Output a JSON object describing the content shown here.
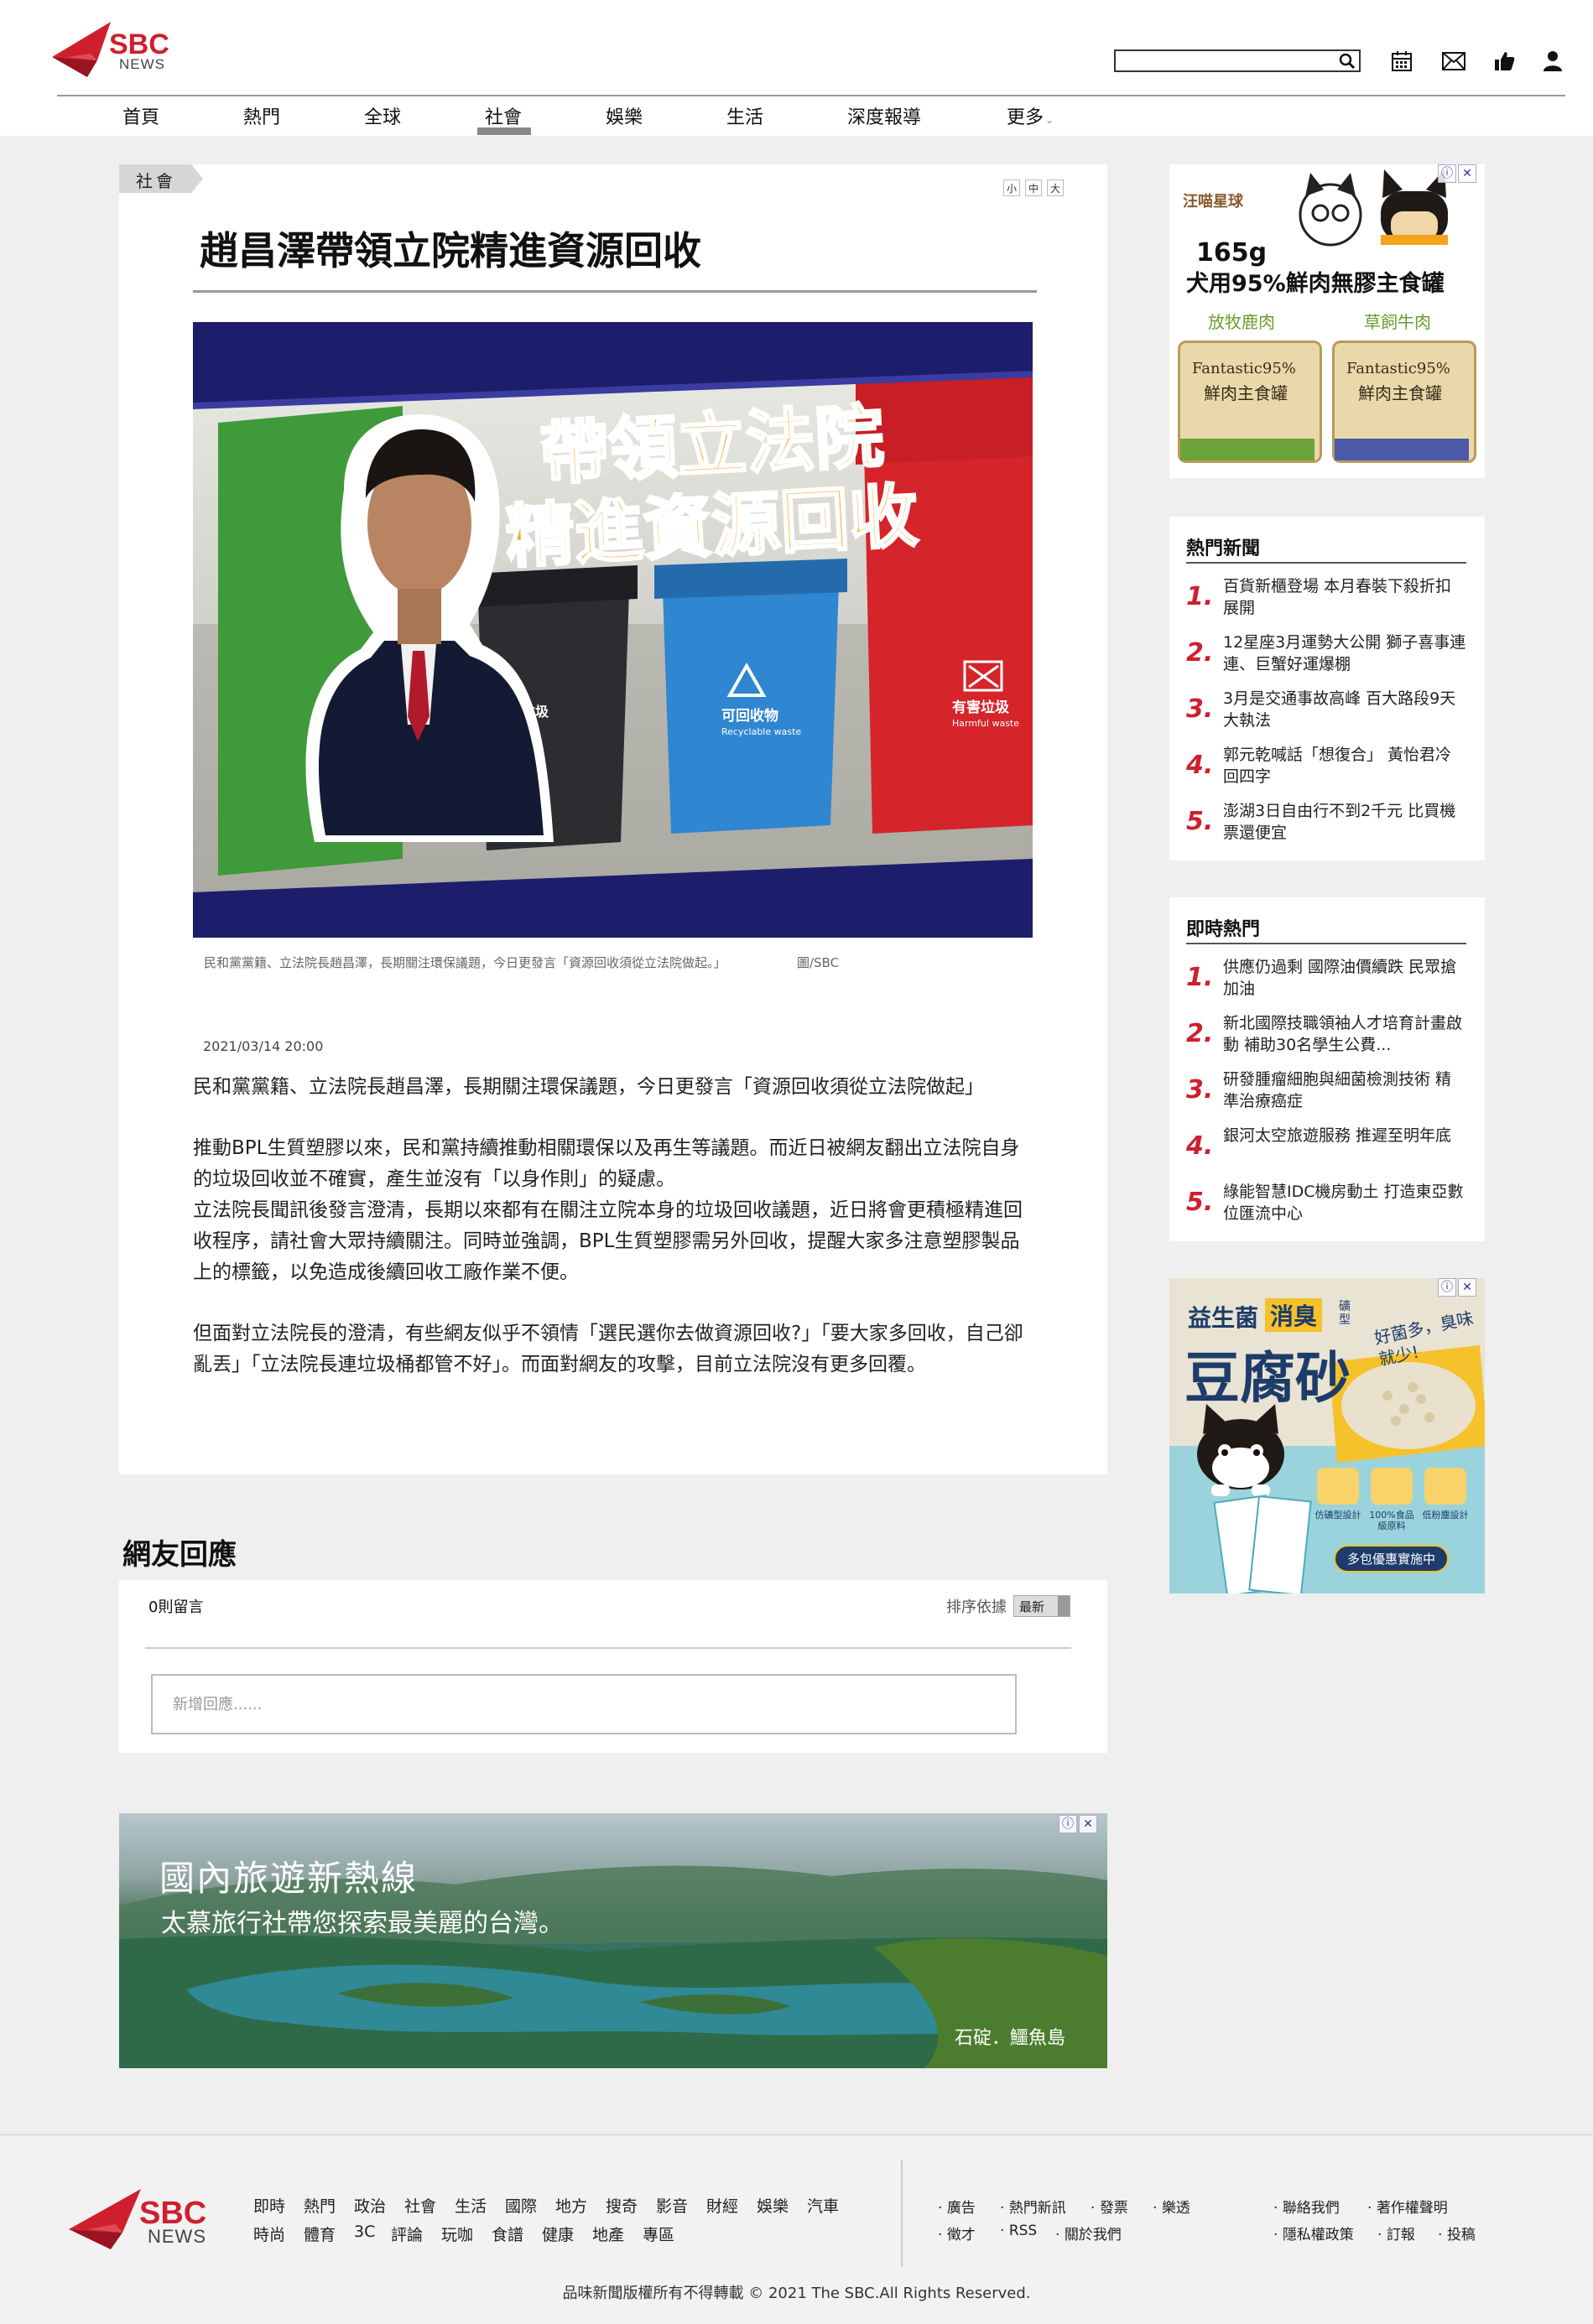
{
  "site": {
    "logo_text": "SBC",
    "logo_sub": "NEWS"
  },
  "search": {
    "placeholder": ""
  },
  "nav": {
    "items": [
      "首頁",
      "熱門",
      "全球",
      "社會",
      "娛樂",
      "生活",
      "深度報導",
      "更多"
    ],
    "active": "社會"
  },
  "article": {
    "category": "社會",
    "font_sizes": [
      "小",
      "中",
      "大"
    ],
    "title": "趙昌澤帶領立院精進資源回收",
    "hero_text_line1": "帶領立法院",
    "hero_text_line2": "精進資源回收",
    "bin_labels": {
      "black": "垃圾",
      "blue": "可回收物",
      "blue_en": "Recyclable waste",
      "red": "有害垃圾",
      "red_en": "Harmful waste"
    },
    "caption": "民和黨黨籍、立法院長趙昌澤，長期關注環保議題，今日更發言「資源回收須從立法院做起。」",
    "caption_credit": "圖/SBC",
    "date": "2021/03/14  20:00",
    "paragraphs": [
      "民和黨黨籍、立法院長趙昌澤，長期關注環保議題，今日更發言「資源回收須從立法院做起」",
      "推動BPL生質塑膠以來，民和黨持續推動相關環保以及再生等議題。而近日被網友翻出立法院自身的垃圾回收並不確實，產生並沒有「以身作則」的疑慮。",
      "立法院長聞訊後發言澄清，長期以來都有在關注立院本身的垃圾回收議題，近日將會更積極精進回收程序，請社會大眾持續關注。同時並強調，BPL生質塑膠需另外回收，提醒大家多注意塑膠製品上的標籤，以免造成後續回收工廠作業不便。",
      "但面對立法院長的澄清，有些網友似乎不領情「選民選你去做資源回收?」「要大家多回收，自己卻亂丟」「立法院長連垃圾桶都管不好」。而面對網友的攻擊，目前立法院沒有更多回覆。"
    ]
  },
  "comments": {
    "title": "網友回應",
    "count": "0則留言",
    "sort_label": "排序依據",
    "sort_value": "最新",
    "input_placeholder": "新增回應......"
  },
  "travel_ad": {
    "title": "國內旅遊新熱線",
    "subtitle": "太慕旅行社帶您探索最美麗的台灣。",
    "location": "石碇．鱷魚島"
  },
  "ad_dog": {
    "brand": "汪喵星球",
    "headline1": "165g",
    "headline2": "犬用95%鮮肉無膠主食罐",
    "flavor1": "放牧鹿肉",
    "flavor2": "草飼牛肉",
    "can_text1": "Fantastic95%",
    "can_text2": "鮮肉主食罐"
  },
  "hot_news": {
    "title": "熱門新聞",
    "items": [
      {
        "rank": "1.",
        "text": "百貨新櫃登場 本月春裝下殺折扣展開"
      },
      {
        "rank": "2.",
        "text": "12星座3月運勢大公開 獅子喜事連連、巨蟹好運爆棚"
      },
      {
        "rank": "3.",
        "text": "3月是交通事故高峰 百大路段9天大執法"
      },
      {
        "rank": "4.",
        "text": "郭元乾喊話「想復合」 黃怡君冷回四字"
      },
      {
        "rank": "5.",
        "text": "澎湖3日自由行不到2千元 比買機票還便宜"
      }
    ]
  },
  "trending": {
    "title": "即時熱門",
    "items": [
      {
        "rank": "1.",
        "text": "供應仍過剩 國際油價續跌 民眾搶加油"
      },
      {
        "rank": "2.",
        "text": "新北國際技職領袖人才培育計畫啟動 補助30名學生公費..."
      },
      {
        "rank": "3.",
        "text": "研發腫瘤細胞與細菌檢測技術 精準治療癌症"
      },
      {
        "rank": "4.",
        "text": "銀河太空旅遊服務 推遲至明年底"
      },
      {
        "rank": "5.",
        "text": "綠能智慧IDC機房動土 打造東亞數位匯流中心"
      }
    ]
  },
  "ad_litter": {
    "line1": "益生菌",
    "badge": "消臭",
    "line1b": "礦型",
    "headline": "豆腐砂",
    "bubble": "好菌多，臭味就少!",
    "feature1": "仿礦型設計",
    "feature2": "100%食品級原料",
    "feature3": "低粉塵設計",
    "cta": "多包優惠實施中"
  },
  "footer": {
    "row1": [
      "即時",
      "熱門",
      "政治",
      "社會",
      "生活",
      "國際",
      "地方",
      "搜奇",
      "影音",
      "財經",
      "娛樂",
      "汽車"
    ],
    "row2": [
      "時尚",
      "體育",
      "3C",
      "評論",
      "玩咖",
      "食譜",
      "健康",
      "地產",
      "專區"
    ],
    "col2_row1": [
      "廣告",
      "熱門新訊",
      "發票",
      "樂透"
    ],
    "col2_row2": [
      "徵才",
      "RSS",
      "關於我們"
    ],
    "col3_row1": [
      "聯絡我們",
      "著作權聲明"
    ],
    "col3_row2": [
      "隱私權政策",
      "訂報",
      "投稿"
    ],
    "copyright": "品味新聞版權所有不得轉載 © 2021 The SBC.All Rights Reserved."
  },
  "colors": {
    "brand_red": "#cf1f2e",
    "hero_navy": "#1c1e6b",
    "hero_text_orange": "#f5a623"
  },
  "icons": [
    "search-icon",
    "calendar-icon",
    "mail-icon",
    "thumbs-up-icon",
    "user-icon",
    "ad-info-icon",
    "ad-close-icon",
    "chevron-down-icon"
  ]
}
